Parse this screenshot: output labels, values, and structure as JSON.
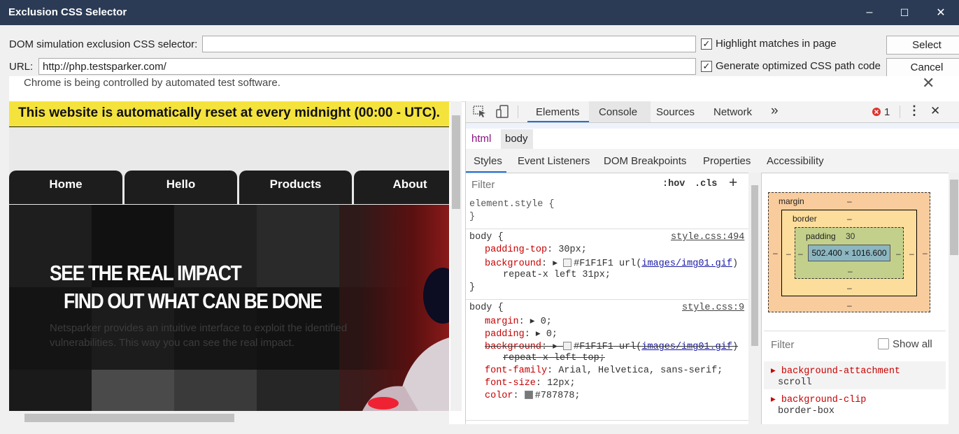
{
  "window": {
    "title": "Exclusion CSS Selector",
    "minimize": "–",
    "maximize": "☐",
    "close": "✕"
  },
  "form": {
    "selector_label": "DOM simulation exclusion CSS selector:",
    "selector_value": "",
    "url_label": "URL:",
    "url_value": "http://php.testsparker.com/",
    "highlight_label": "Highlight matches in page",
    "highlight_checked": "✓",
    "optimize_label": "Generate optimized CSS path code",
    "optimize_checked": "✓",
    "select_button": "Select",
    "cancel_button": "Cancel"
  },
  "infobar": {
    "text": "Chrome is being controlled by automated test software.",
    "close": "✕"
  },
  "site": {
    "banner": "This website is automatically reset at every midnight (00:00 - UTC).",
    "nav": [
      "Home",
      "Hello",
      "Products",
      "About"
    ],
    "headline1": "SEE THE REAL IMPACT",
    "headline2": "FIND OUT WHAT CAN BE DONE",
    "paragraph": "Netsparker provides an intuitive interface to exploit the identified vulnerabilities. This way you can see the real impact."
  },
  "devtools": {
    "tabs": [
      "Elements",
      "Console",
      "Sources",
      "Network"
    ],
    "more": "»",
    "error_count": "1",
    "menu": "⋮",
    "close": "✕",
    "crumbs": [
      "html",
      "body"
    ],
    "subtabs": [
      "Styles",
      "Event Listeners",
      "DOM Breakpoints",
      "Properties",
      "Accessibility"
    ],
    "filter_placeholder": "Filter",
    "hov": ":hov",
    "cls": ".cls",
    "plus": "+",
    "element_style": "element.style {",
    "close_brace": "}",
    "rule1": {
      "selector": "body {",
      "source": "style.css:494",
      "p1_name": "padding-top",
      "p1_value": "30px;",
      "p2_name": "background",
      "p2_color": "#F1F1F1",
      "p2_url_prefix": "url(",
      "p2_url": "images/img01.gif",
      "p2_url_suffix": ")",
      "p2_cont": "repeat-x left 31px;"
    },
    "rule2": {
      "selector": "body {",
      "source": "style.css:9",
      "margin": "margin",
      "margin_val": "0;",
      "padding": "padding",
      "padding_val": "0;",
      "bg": "background",
      "bg_color": "#F1F1F1",
      "bg_url_prefix": "url(",
      "bg_url": "images/img01.gif",
      "bg_url_suffix": ")",
      "bg_cont": "repeat-x left top;",
      "ff": "font-family",
      "ff_val": "Arial, Helvetica, sans-serif;",
      "fs": "font-size",
      "fs_val": "12px;",
      "color": "color",
      "color_val": "#787878;"
    },
    "boxmodel": {
      "margin": "margin",
      "border": "border",
      "padding": "padding",
      "padding_val": "30",
      "size": "502.400 × 1016.600",
      "dash": "–"
    },
    "computed": {
      "filter": "Filter",
      "show_all": "Show all",
      "p1": "background-attachment",
      "v1": "scroll",
      "p2": "background-clip",
      "v2": "border-box"
    }
  },
  "colors": {
    "titlebar": "#2b3b55",
    "banner": "#f5e33d",
    "prop": "#c80000",
    "margin_box": "#f9cc9d",
    "border_box": "#fddd9b",
    "padding_box": "#c3d08b",
    "content_box": "#8cb6c0"
  }
}
